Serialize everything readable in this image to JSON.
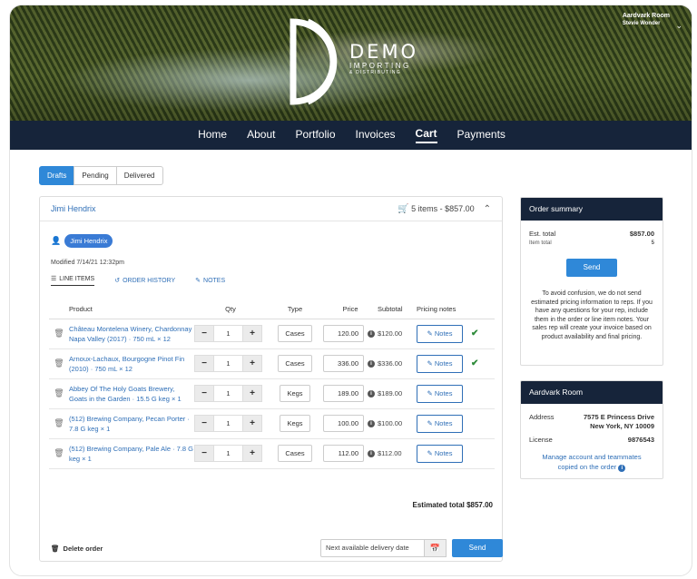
{
  "brand": {
    "line1": "DEMO",
    "line2": "IMPORTING",
    "line3": "& DISTRIBUTING"
  },
  "account": {
    "name": "Aardvark Room",
    "user": "Stevie Wonder"
  },
  "nav": [
    "Home",
    "About",
    "Portfolio",
    "Invoices",
    "Cart",
    "Payments"
  ],
  "nav_active": "Cart",
  "status_tabs": [
    "Drafts",
    "Pending",
    "Delivered"
  ],
  "order": {
    "customer": "Jimi Hendrix",
    "cart_summary": "5 items - $857.00",
    "chip": "Jimi Hendrix",
    "modified": "Modified 7/14/21 12:32pm",
    "subtabs": {
      "line_items": "LINE ITEMS",
      "order_history": "ORDER HISTORY",
      "notes": "NOTES"
    },
    "columns": {
      "product": "Product",
      "qty": "Qty",
      "type": "Type",
      "price": "Price",
      "subtotal": "Subtotal",
      "notes": "Pricing notes"
    },
    "lines": [
      {
        "name": "Château Montelena Winery, Chardonnay Napa Valley (2017) · 750 mL × 12",
        "qty": "1",
        "type": "Cases",
        "price": "120.00",
        "subtotal": "$120.00",
        "notes": "Notes",
        "checked": true
      },
      {
        "name": "Arnoux-Lachaux, Bourgogne Pinot Fin (2010) · 750 mL × 12",
        "qty": "1",
        "type": "Cases",
        "price": "336.00",
        "subtotal": "$336.00",
        "notes": "Notes",
        "checked": true
      },
      {
        "name": "Abbey Of The Holy Goats Brewery, Goats in the Garden · 15.5 G keg × 1",
        "qty": "1",
        "type": "Kegs",
        "price": "189.00",
        "subtotal": "$189.00",
        "notes": "Notes",
        "checked": false
      },
      {
        "name": "(512) Brewing Company, Pecan Porter · 7.8 G keg × 1",
        "qty": "1",
        "type": "Kegs",
        "price": "100.00",
        "subtotal": "$100.00",
        "notes": "Notes",
        "checked": false
      },
      {
        "name": "(512) Brewing Company, Pale Ale · 7.8 G keg × 1",
        "qty": "1",
        "type": "Cases",
        "price": "112.00",
        "subtotal": "$112.00",
        "notes": "Notes",
        "checked": false
      }
    ],
    "estimated_total": "Estimated total $857.00",
    "delete_label": "Delete order",
    "delivery_placeholder": "Next available delivery date",
    "send_label": "Send"
  },
  "summary": {
    "title": "Order summary",
    "est_label": "Est. total",
    "est_value": "$857.00",
    "count_label": "Item total",
    "count_value": "5",
    "send_label": "Send",
    "note": "To avoid confusion, we do not send estimated pricing information to reps. If you have any questions for your rep, include them in the order or line item notes. Your sales rep will create your invoice based on product availability and final pricing."
  },
  "room": {
    "title": "Aardvark Room",
    "address_label": "Address",
    "address_line1": "7575 E Princess Drive",
    "address_line2": "New York, NY 10009",
    "license_label": "License",
    "license_value": "9876543",
    "manage_line1": "Manage account and teammates",
    "manage_line2": "copied on the order"
  },
  "icons": {
    "cart": "cart-icon",
    "trash": "trash-icon",
    "person": "person-icon",
    "info": "info-icon",
    "check": "check-icon",
    "pencil": "pencil-icon",
    "calendar": "calendar-icon",
    "chevron": "chevron-down-icon",
    "collapse": "chevron-up-icon"
  },
  "colors": {
    "navy": "#16243a",
    "accent": "#2f88d8",
    "link": "#2f6fb7",
    "check": "#2e8b3a"
  }
}
